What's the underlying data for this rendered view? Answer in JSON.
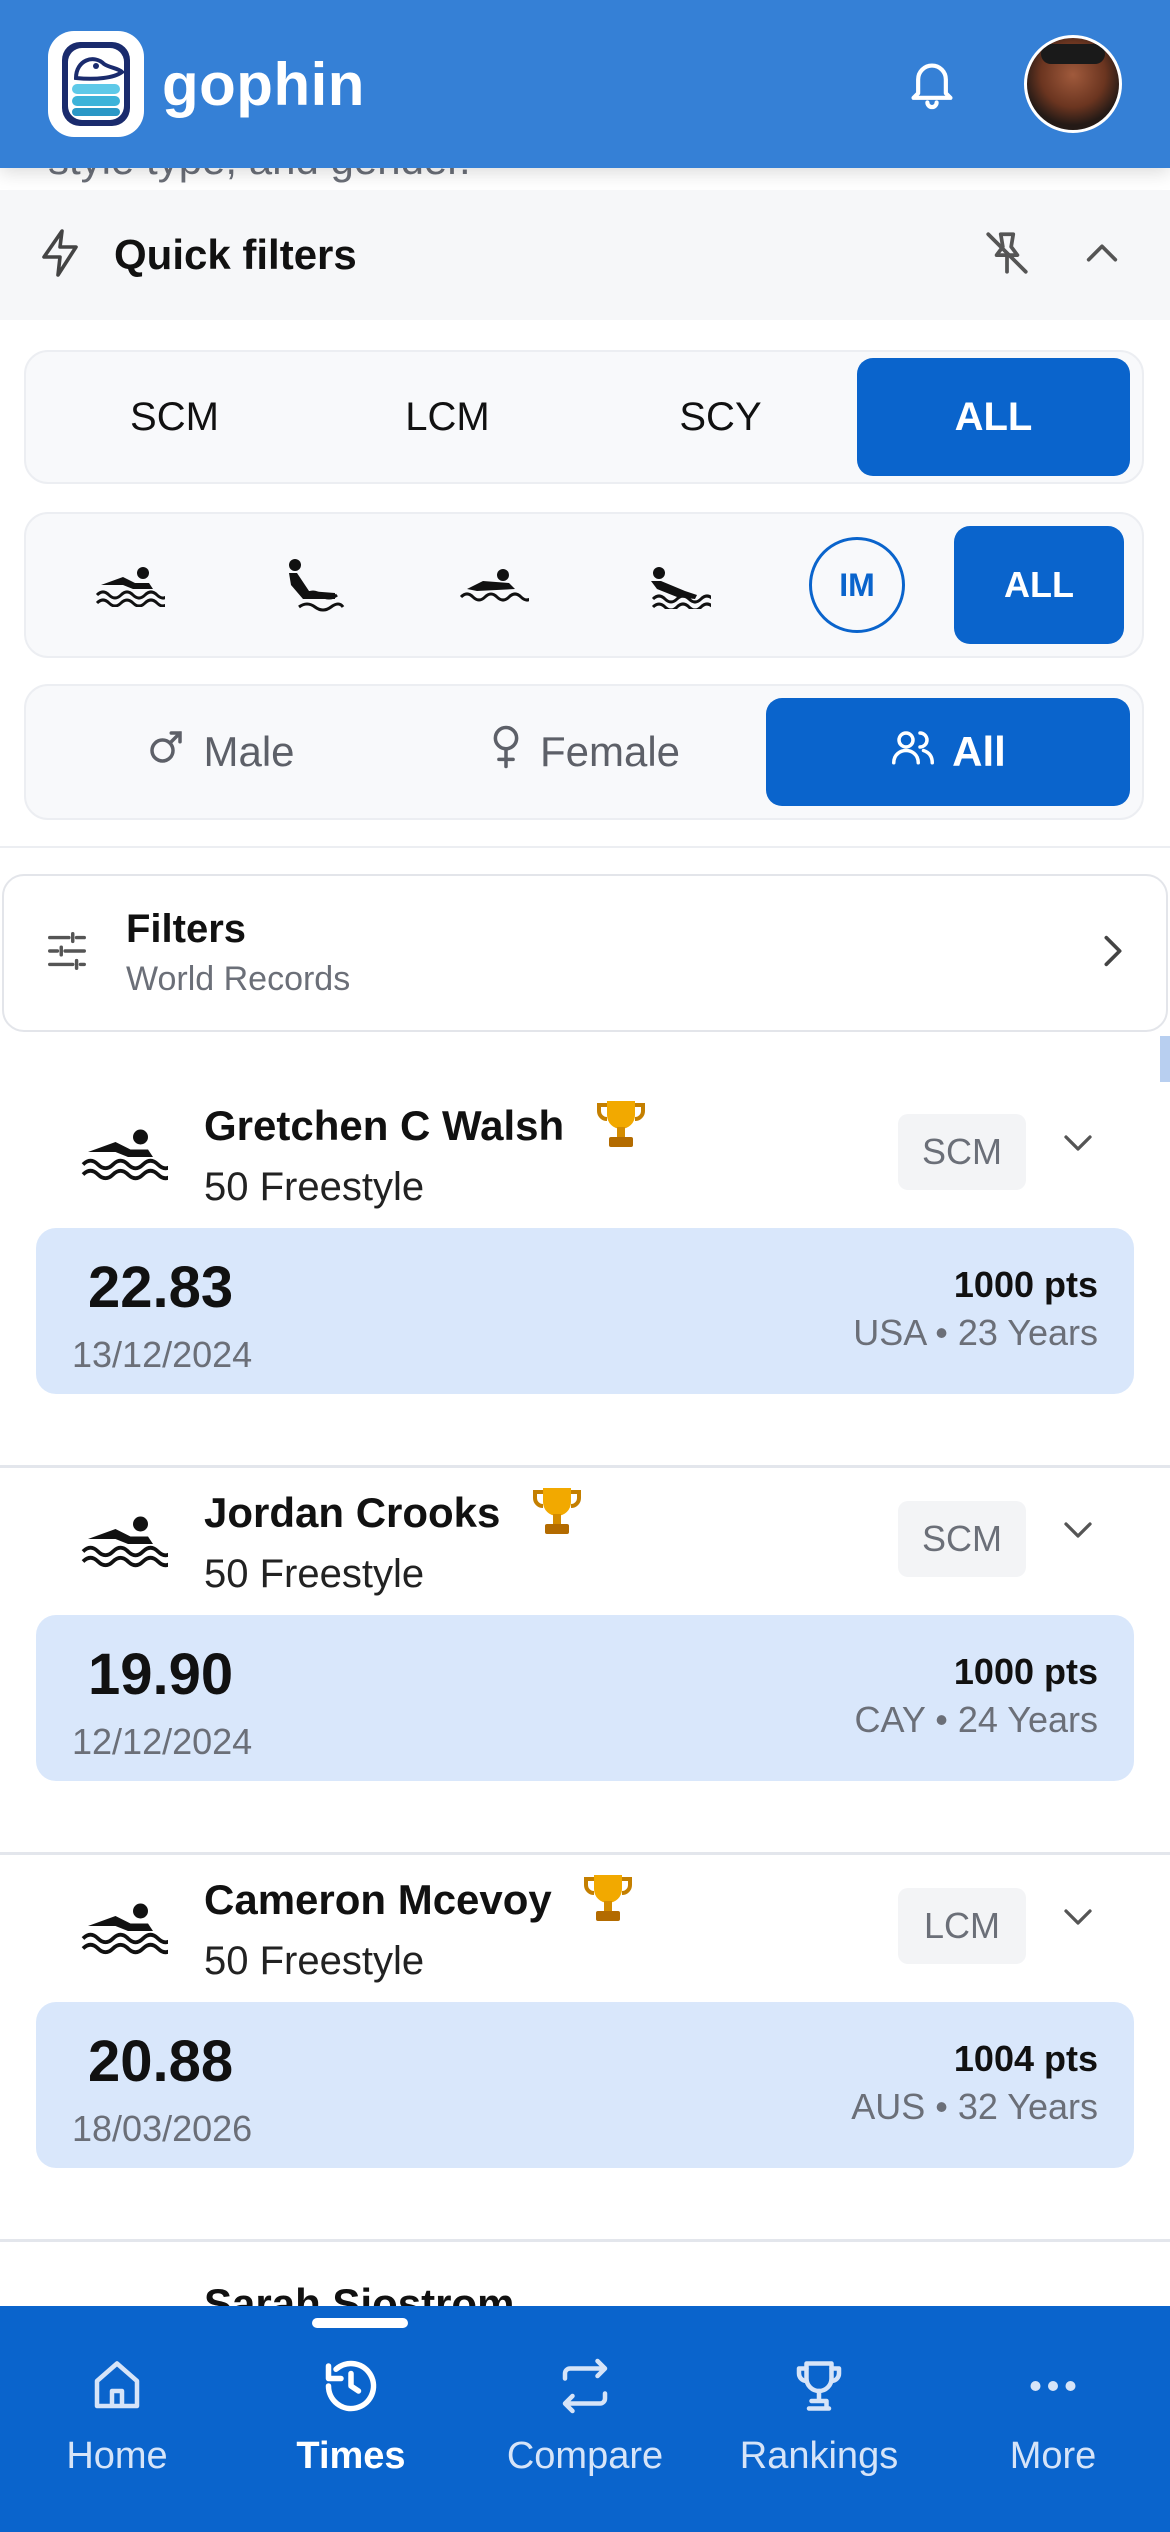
{
  "header": {
    "brand": "gophin",
    "colors": {
      "bar": "#3580d6",
      "accent": "#0a64cc"
    },
    "icons": [
      "gophin-logo",
      "bell-icon",
      "avatar"
    ]
  },
  "page": {
    "cut_subtitle": "style type, and gender."
  },
  "quick_filters": {
    "title": "Quick filters",
    "course": {
      "options": [
        "SCM",
        "LCM",
        "SCY",
        "ALL"
      ],
      "selected": "ALL"
    },
    "strokes": {
      "options": [
        "freestyle",
        "backstroke",
        "breaststroke",
        "butterfly",
        "IM",
        "ALL"
      ],
      "im_label": "IM",
      "all_label": "ALL",
      "selected": "ALL"
    },
    "gender": {
      "male": "Male",
      "female": "Female",
      "all": "All",
      "selected": "All"
    }
  },
  "filters": {
    "title": "Filters",
    "subtitle": "World Records"
  },
  "results": [
    {
      "name": "Gretchen C Walsh",
      "event": "50 Freestyle",
      "course": "SCM",
      "time": "22.83",
      "date": "13/12/2024",
      "points": "1000 pts",
      "meta": "USA • 23 Years"
    },
    {
      "name": "Jordan Crooks",
      "event": "50 Freestyle",
      "course": "SCM",
      "time": "19.90",
      "date": "12/12/2024",
      "points": "1000 pts",
      "meta": "CAY • 24 Years"
    },
    {
      "name": "Cameron Mcevoy",
      "event": "50 Freestyle",
      "course": "LCM",
      "time": "20.88",
      "date": "18/03/2026",
      "points": "1004 pts",
      "meta": "AUS • 32 Years"
    }
  ],
  "partial_next": "Sarah Sjostrom",
  "nav": {
    "items": [
      {
        "label": "Home",
        "icon": "home-icon"
      },
      {
        "label": "Times",
        "icon": "history-icon"
      },
      {
        "label": "Compare",
        "icon": "compare-icon"
      },
      {
        "label": "Rankings",
        "icon": "trophy-icon"
      },
      {
        "label": "More",
        "icon": "more-icon"
      }
    ],
    "active": "Times"
  }
}
